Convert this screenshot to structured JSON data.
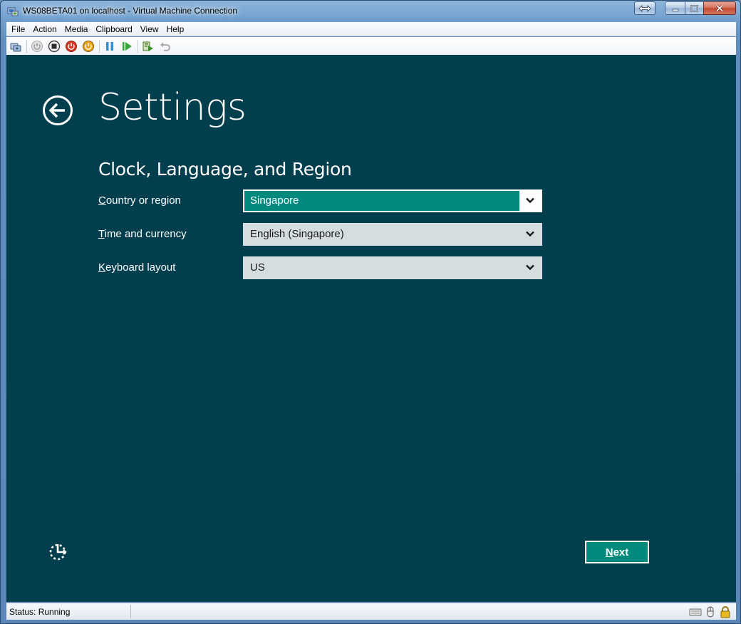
{
  "window": {
    "title": "WS08BETA01 on localhost - Virtual Machine Connection"
  },
  "menu": {
    "items": [
      "File",
      "Action",
      "Media",
      "Clipboard",
      "View",
      "Help"
    ]
  },
  "toolbar": {
    "buttons": [
      "ctrl-alt-del-icon",
      "start-icon",
      "turn-off-icon",
      "shutdown-icon",
      "save-icon",
      "pause-icon",
      "resume-icon",
      "snapshot-icon",
      "revert-icon"
    ]
  },
  "setup": {
    "title": "Settings",
    "section": "Clock, Language, and Region",
    "fields": [
      {
        "label_accel": "C",
        "label_rest": "ountry or region",
        "value": "Singapore"
      },
      {
        "label_accel": "T",
        "label_rest": "ime and currency",
        "value": "English (Singapore)"
      },
      {
        "label_accel": "K",
        "label_rest": "eyboard layout",
        "value": "US"
      }
    ],
    "next_accel": "N",
    "next_rest": "ext"
  },
  "status": {
    "text": "Status: Running"
  },
  "colors": {
    "vm_background": "#023f4e",
    "accent": "#00897e",
    "select_bg": "#d5dde1"
  }
}
